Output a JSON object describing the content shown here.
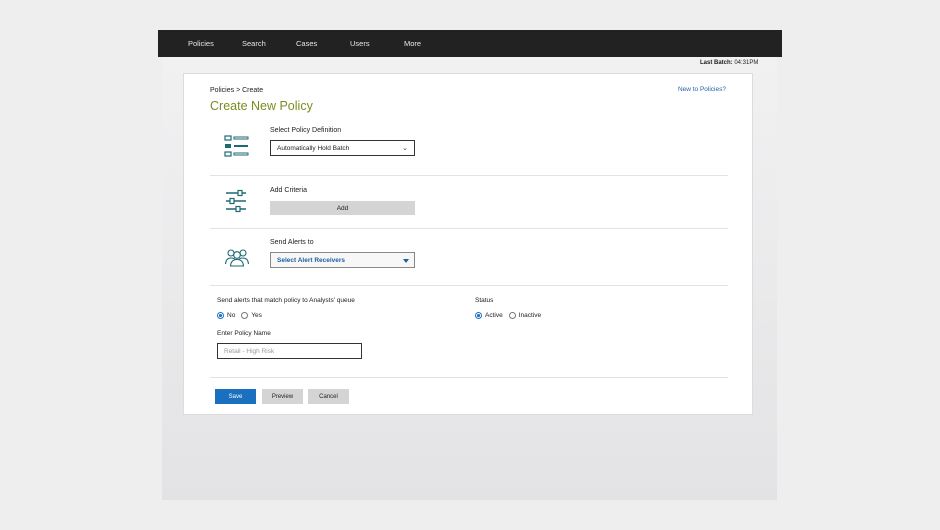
{
  "nav": {
    "items": [
      {
        "label": "Policies"
      },
      {
        "label": "Search"
      },
      {
        "label": "Cases"
      },
      {
        "label": "Users"
      },
      {
        "label": "More"
      }
    ]
  },
  "last_batch": {
    "label": "Last Batch:",
    "value": "04:31PM"
  },
  "page": {
    "breadcrumb": {
      "parent": "Policies",
      "separator": ">",
      "current": "Create"
    },
    "help_link": "New to Policies?",
    "title": "Create New Policy"
  },
  "sections": {
    "definition": {
      "icon": "list-icon",
      "label": "Select Policy Definition",
      "selected": "Automatically Hold Batch"
    },
    "criteria": {
      "icon": "sliders-icon",
      "label": "Add Criteria",
      "button": "Add"
    },
    "alerts": {
      "icon": "users-group-icon",
      "label": "Send Alerts to",
      "selected": "Select Alert Receivers"
    }
  },
  "options": {
    "queue": {
      "label": "Send alerts that match policy to Analysts' queue",
      "choices": [
        "No",
        "Yes"
      ],
      "selected": "No"
    },
    "status": {
      "label": "Status",
      "choices": [
        "Active",
        "Inactive"
      ],
      "selected": "Active"
    },
    "policy_name": {
      "label": "Enter Policy Name",
      "placeholder": "Retail - High Risk"
    }
  },
  "actions": {
    "save": "Save",
    "preview": "Preview",
    "cancel": "Cancel"
  },
  "colors": {
    "nav_bg": "#222222",
    "title": "#7d8b1f",
    "primary": "#1a6fbf",
    "icon": "#1d6a72",
    "link": "#2563a8"
  }
}
